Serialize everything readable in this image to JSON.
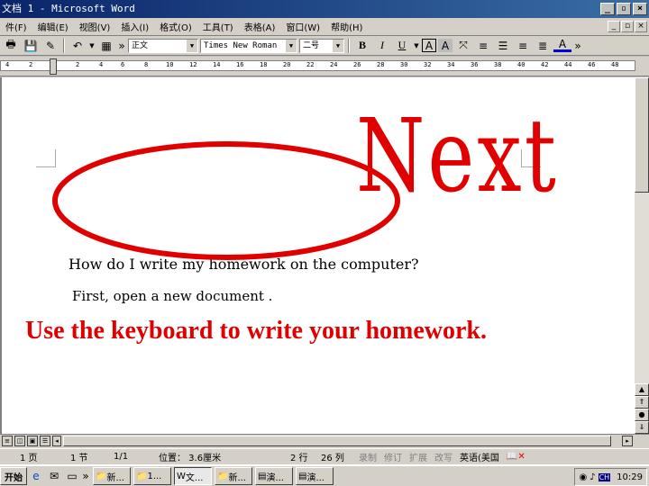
{
  "window": {
    "title": "文档 1 - Microsoft Word"
  },
  "menu": {
    "items": [
      "件(F)",
      "编辑(E)",
      "视图(V)",
      "插入(I)",
      "格式(O)",
      "工具(T)",
      "表格(A)",
      "窗口(W)",
      "帮助(H)"
    ]
  },
  "toolbar": {
    "style_value": "正文",
    "font_value": "Times New Roman",
    "size_value": "二号",
    "bold": "B",
    "italic": "I",
    "underline": "U"
  },
  "ruler": {
    "ticks": [
      "4",
      "2",
      "",
      "2",
      "4",
      "6",
      "8",
      "10",
      "12",
      "14",
      "16",
      "18",
      "20",
      "22",
      "24",
      "26",
      "28",
      "30",
      "32",
      "34",
      "36",
      "38",
      "40",
      "42",
      "44",
      "46",
      "48"
    ]
  },
  "document": {
    "line1": "How do I write my homework on the computer?",
    "line2": "First, open a new document .",
    "overlay_next": "Next",
    "instruction": "Use the keyboard to write your homework.",
    "accent_color": "#e00000"
  },
  "status": {
    "page": "1 页",
    "section": "1 节",
    "pages": "1/1",
    "position": "位置： 3.6厘米",
    "line": "2 行",
    "column": "26 列",
    "rec": "录制",
    "trk": "修订",
    "ext": "扩展",
    "ovr": "改写",
    "lang": "英语(美国"
  },
  "taskbar": {
    "start": "开始",
    "buttons": [
      "新...",
      "1...",
      "文...",
      "新...",
      "演...",
      "演..."
    ],
    "clock": "10:29"
  }
}
